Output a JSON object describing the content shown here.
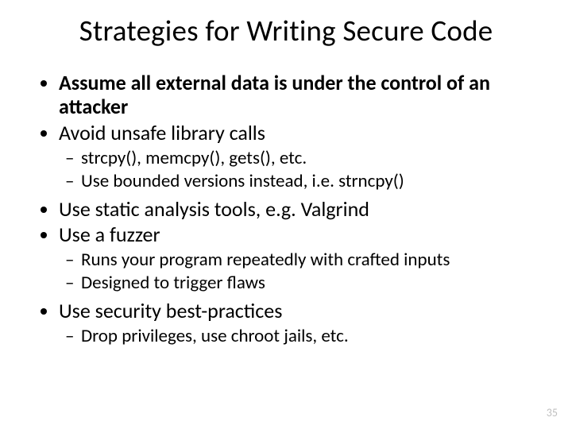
{
  "title": "Strategies for Writing Secure Code",
  "bullets": {
    "b1": "Assume all external data is under the control of an attacker",
    "b2": "Avoid unsafe library calls",
    "b2s": {
      "a": "strcpy(), memcpy(), gets(), etc.",
      "b": "Use bounded versions instead, i.e. strncpy()"
    },
    "b3": "Use static analysis tools, e.g. Valgrind",
    "b4": "Use a fuzzer",
    "b4s": {
      "a": "Runs your program repeatedly with crafted inputs",
      "b": "Designed to trigger flaws"
    },
    "b5": "Use security best-practices",
    "b5s": {
      "a": "Drop privileges, use chroot jails, etc."
    }
  },
  "page_number": "35"
}
